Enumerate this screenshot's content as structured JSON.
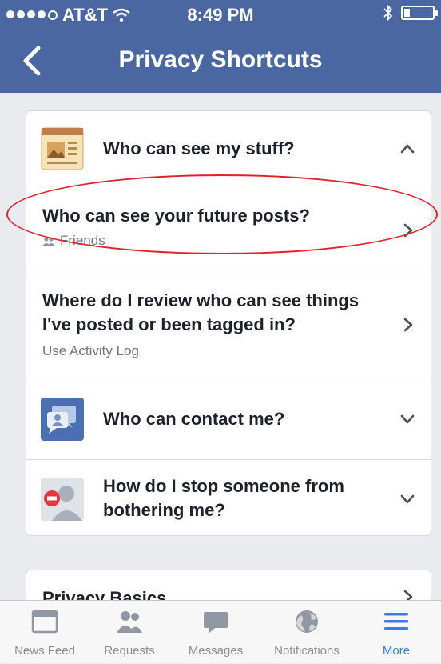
{
  "status": {
    "carrier": "AT&T",
    "time": "8:49 PM",
    "battery_level": 0.2
  },
  "nav": {
    "title": "Privacy Shortcuts",
    "back_icon": "chevron-left-icon"
  },
  "sections": {
    "stuff": {
      "title": "Who can see my stuff?",
      "icon": "news-page-icon"
    },
    "future_posts": {
      "title": "Who can see your future posts?",
      "sub": "Friends",
      "sub_icon": "friends-icon"
    },
    "review": {
      "title": "Where do I review who can see things I've posted or been tagged in?",
      "sub": "Use Activity Log"
    },
    "contact": {
      "title": "Who can contact me?",
      "icon": "contact-chat-icon"
    },
    "stop": {
      "title": "How do I stop someone from bothering me?",
      "icon": "block-person-icon"
    }
  },
  "basics": {
    "title": "Privacy Basics"
  },
  "tabs": [
    {
      "label": "News Feed",
      "icon": "news-feed-icon"
    },
    {
      "label": "Requests",
      "icon": "friend-requests-icon"
    },
    {
      "label": "Messages",
      "icon": "messages-icon"
    },
    {
      "label": "Notifications",
      "icon": "globe-icon"
    },
    {
      "label": "More",
      "icon": "menu-icon"
    }
  ],
  "colors": {
    "header": "#4a67a1",
    "active_tab": "#3b7be5",
    "annotation": "#e2222a"
  }
}
